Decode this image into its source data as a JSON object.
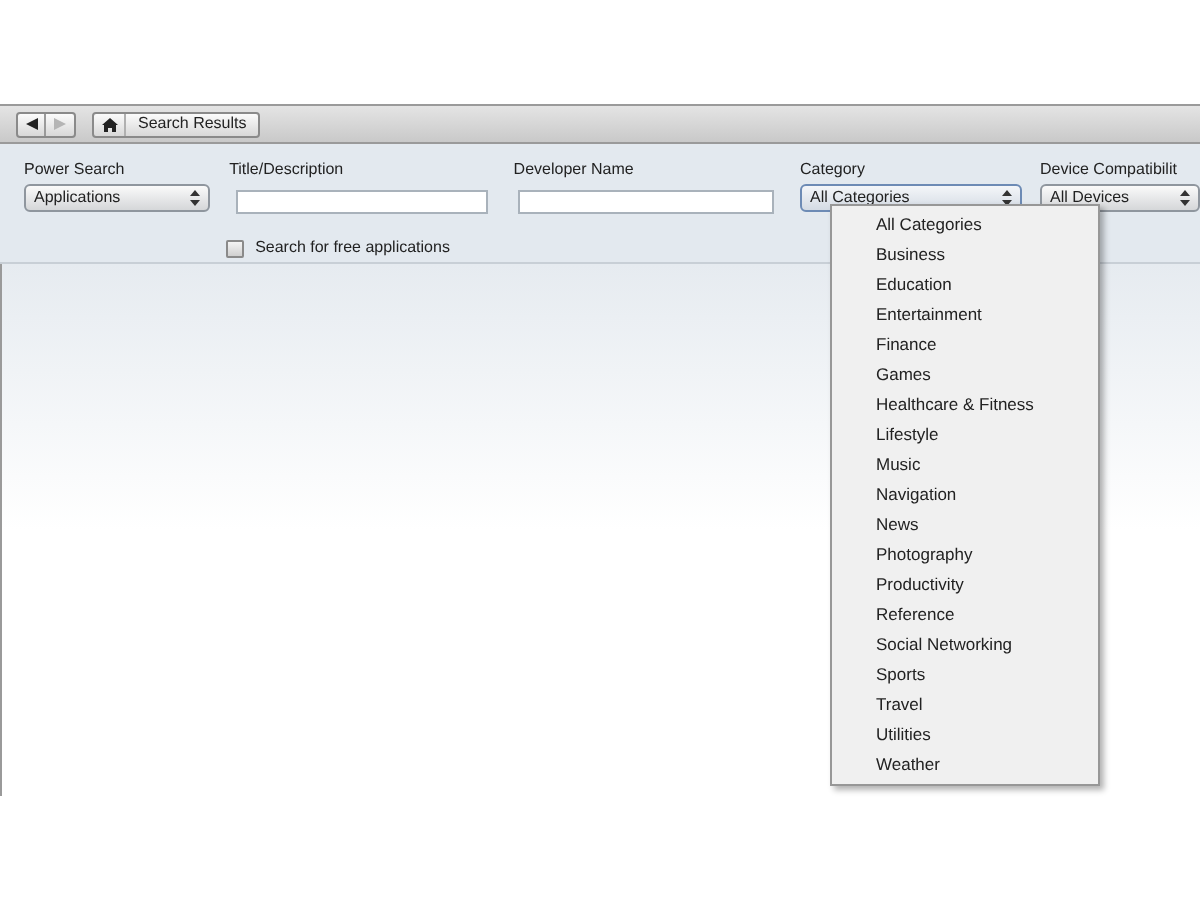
{
  "toolbar": {
    "back": {
      "disabled": false
    },
    "forward": {
      "disabled": true
    },
    "breadcrumb": "Search Results"
  },
  "form": {
    "power_search": {
      "label": "Power Search",
      "value": "Applications"
    },
    "title_description": {
      "label": "Title/Description"
    },
    "developer_name": {
      "label": "Developer Name"
    },
    "category": {
      "label": "Category",
      "value": "All Categories",
      "expanded": true
    },
    "device_compatibility": {
      "label": "Device Compatibilit",
      "value": "All Devices"
    },
    "free_apps": {
      "label": "Search for free applications",
      "checked": false
    }
  },
  "category_options": [
    "All Categories",
    "Business",
    "Education",
    "Entertainment",
    "Finance",
    "Games",
    "Healthcare & Fitness",
    "Lifestyle",
    "Music",
    "Navigation",
    "News",
    "Photography",
    "Productivity",
    "Reference",
    "Social Networking",
    "Sports",
    "Travel",
    "Utilities",
    "Weather"
  ]
}
